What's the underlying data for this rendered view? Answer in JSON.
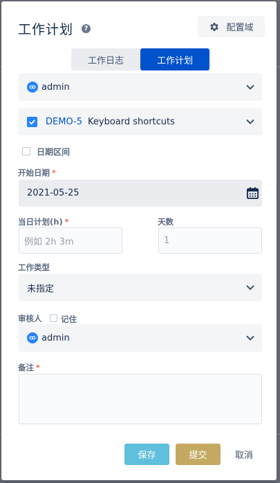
{
  "dialog": {
    "title": "工作计划",
    "config_label": "配置域"
  },
  "tabs": [
    {
      "label": "工作日志",
      "active": false
    },
    {
      "label": "工作计划",
      "active": true
    }
  ],
  "user_select": {
    "value": "admin",
    "icon": "user-avatar-icon"
  },
  "issue_select": {
    "checked": true,
    "key": "DEMO-5",
    "summary": "Keyboard shortcuts"
  },
  "date_range": {
    "label": "日期区间",
    "checked": false
  },
  "start_date": {
    "label": "开始日期",
    "required": "*",
    "value": "2021-05-25"
  },
  "daily_plan": {
    "label": "当日计划(h)",
    "required": "*",
    "placeholder": "例如 2h 3m"
  },
  "days": {
    "label": "天数",
    "placeholder": "1"
  },
  "work_type": {
    "label": "工作类型",
    "value": "未指定"
  },
  "reviewer": {
    "label": "审核人",
    "remember_label": "记住",
    "remember_checked": false,
    "value": "admin"
  },
  "remarks": {
    "label": "备注",
    "required": "*",
    "value": ""
  },
  "footer": {
    "save": "保存",
    "submit": "提交",
    "cancel": "取消"
  },
  "colors": {
    "primary": "#0052cc",
    "save_button": "#5fbfdc",
    "submit_button": "#c4a961",
    "required": "#de350b"
  }
}
